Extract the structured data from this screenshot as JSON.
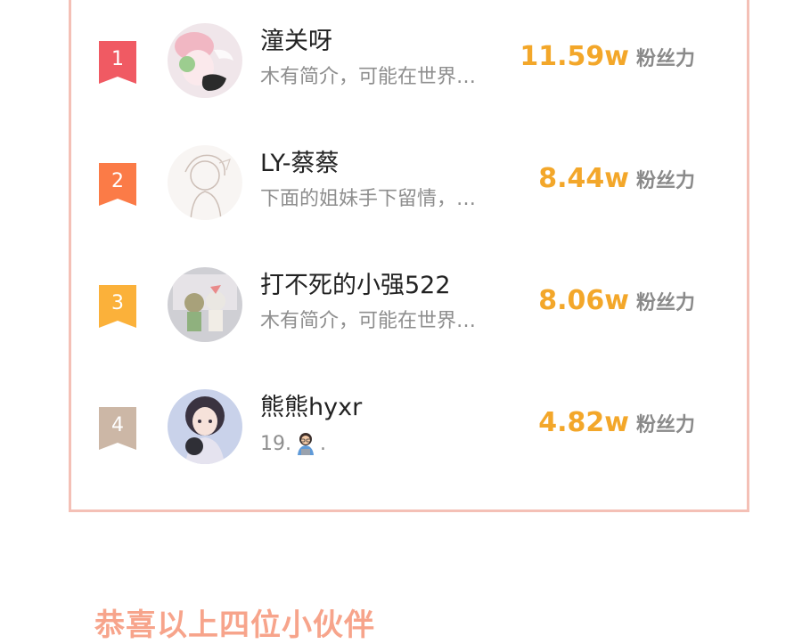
{
  "ranking": {
    "entries": [
      {
        "rank": "1",
        "name": "潼关呀",
        "bio": "木有简介，可能在世界…",
        "value": "11.59w",
        "unit": "粉丝力",
        "badge_color": "#f05a63"
      },
      {
        "rank": "2",
        "name": "LY-蔡蔡",
        "bio": "下面的姐妹手下留情，…",
        "value": "8.44w",
        "unit": "粉丝力",
        "badge_color": "#fb7b47"
      },
      {
        "rank": "3",
        "name": "打不死的小强522",
        "bio": "木有简介，可能在世界…",
        "value": "8.06w",
        "unit": "粉丝力",
        "badge_color": "#fbb13a"
      },
      {
        "rank": "4",
        "name": "熊熊hyxr",
        "bio": "19.",
        "bio_tail": ".",
        "value": "4.82w",
        "unit": "粉丝力",
        "badge_color": "#ccb7a6"
      }
    ]
  },
  "footer": {
    "text": "恭喜以上四位小伙伴"
  },
  "colors": {
    "accent_value": "#f3a72a",
    "card_border": "#f4c0b6",
    "footer_text": "#f7a48b"
  }
}
